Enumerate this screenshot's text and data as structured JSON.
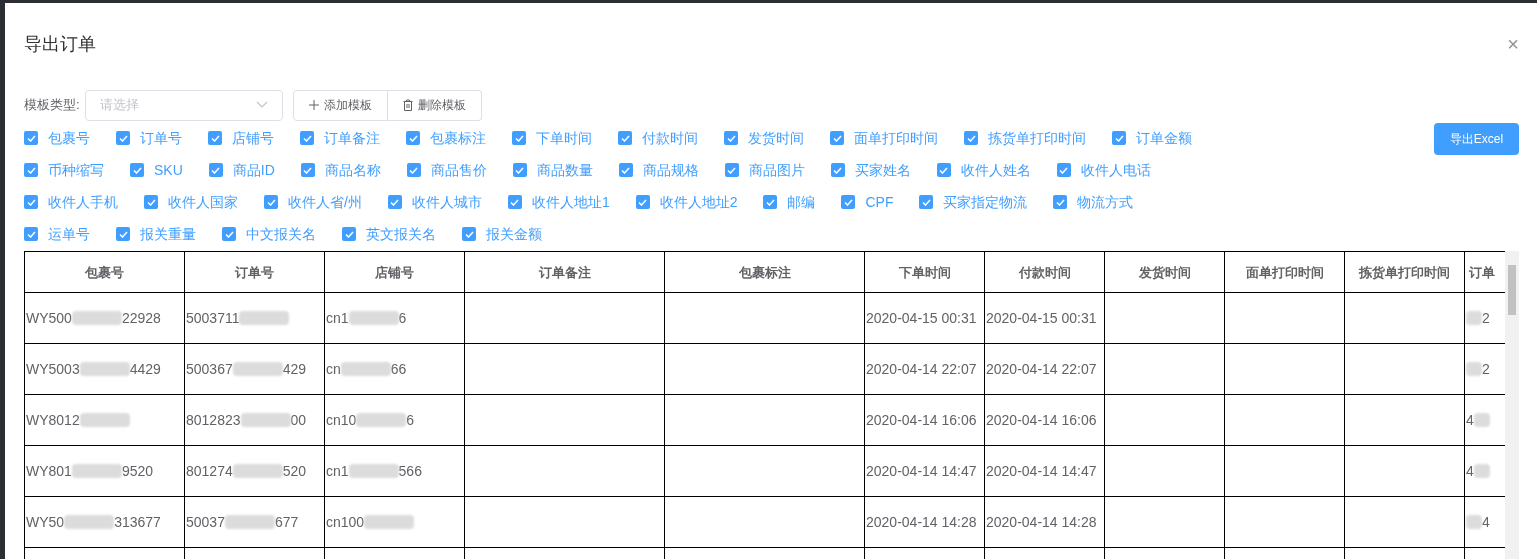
{
  "dialog": {
    "title": "导出订单",
    "close": "×"
  },
  "template": {
    "label": "模板类型:",
    "placeholder": "请选择",
    "add_button": "添加模板",
    "delete_button": "删除模板"
  },
  "export_button": "导出Excel",
  "field_rows": [
    [
      {
        "label": "包裹号",
        "checked": true
      },
      {
        "label": "订单号",
        "checked": true
      },
      {
        "label": "店铺号",
        "checked": true
      },
      {
        "label": "订单备注",
        "checked": true
      },
      {
        "label": "包裹标注",
        "checked": true
      },
      {
        "label": "下单时间",
        "checked": true
      },
      {
        "label": "付款时间",
        "checked": true
      },
      {
        "label": "发货时间",
        "checked": true
      },
      {
        "label": "面单打印时间",
        "checked": true
      },
      {
        "label": "拣货单打印时间",
        "checked": true
      },
      {
        "label": "订单金额",
        "checked": true
      }
    ],
    [
      {
        "label": "币种缩写",
        "checked": true
      },
      {
        "label": "SKU",
        "checked": true
      },
      {
        "label": "商品ID",
        "checked": true
      },
      {
        "label": "商品名称",
        "checked": true
      },
      {
        "label": "商品售价",
        "checked": true
      },
      {
        "label": "商品数量",
        "checked": true
      },
      {
        "label": "商品规格",
        "checked": true
      },
      {
        "label": "商品图片",
        "checked": true
      },
      {
        "label": "买家姓名",
        "checked": true
      },
      {
        "label": "收件人姓名",
        "checked": true
      },
      {
        "label": "收件人电话",
        "checked": true
      }
    ],
    [
      {
        "label": "收件人手机",
        "checked": true
      },
      {
        "label": "收件人国家",
        "checked": true
      },
      {
        "label": "收件人省/州",
        "checked": true
      },
      {
        "label": "收件人城市",
        "checked": true
      },
      {
        "label": "收件人地址1",
        "checked": true
      },
      {
        "label": "收件人地址2",
        "checked": true
      },
      {
        "label": "邮编",
        "checked": true
      },
      {
        "label": "CPF",
        "checked": true
      },
      {
        "label": "买家指定物流",
        "checked": true
      },
      {
        "label": "物流方式",
        "checked": true
      }
    ],
    [
      {
        "label": "运单号",
        "checked": true
      },
      {
        "label": "报关重量",
        "checked": true
      },
      {
        "label": "中文报关名",
        "checked": true
      },
      {
        "label": "英文报关名",
        "checked": true
      },
      {
        "label": "报关金额",
        "checked": true
      }
    ]
  ],
  "table": {
    "columns": [
      "包裹号",
      "订单号",
      "店铺号",
      "订单备注",
      "包裹标注",
      "下单时间",
      "付款时间",
      "发货时间",
      "面单打印时间",
      "拣货单打印时间",
      "订单"
    ],
    "rows": [
      [
        [
          "WY500",
          "22928"
        ],
        [
          "5003711",
          ""
        ],
        [
          "cn1",
          "6"
        ],
        [],
        [],
        [
          "2020-04-15 00:31"
        ],
        [
          "2020-04-15 00:31"
        ],
        [],
        [],
        [],
        [
          "",
          "2"
        ]
      ],
      [
        [
          "WY5003",
          "4429"
        ],
        [
          "500367",
          "429"
        ],
        [
          "cn",
          "66"
        ],
        [],
        [],
        [
          "2020-04-14 22:07"
        ],
        [
          "2020-04-14 22:07"
        ],
        [],
        [],
        [],
        [
          "",
          "2"
        ]
      ],
      [
        [
          "WY8012",
          ""
        ],
        [
          "8012823",
          "00"
        ],
        [
          "cn10",
          "6"
        ],
        [],
        [],
        [
          "2020-04-14 16:06"
        ],
        [
          "2020-04-14 16:06"
        ],
        [],
        [],
        [],
        [
          "4",
          ""
        ]
      ],
      [
        [
          "WY801",
          "9520"
        ],
        [
          "801274",
          "520"
        ],
        [
          "cn1",
          "566"
        ],
        [],
        [],
        [
          "2020-04-14 14:47"
        ],
        [
          "2020-04-14 14:47"
        ],
        [],
        [],
        [],
        [
          "4",
          ""
        ]
      ],
      [
        [
          "WY50",
          "313677"
        ],
        [
          "50037",
          "677"
        ],
        [
          "cn100",
          ""
        ],
        [],
        [],
        [
          "2020-04-14 14:28"
        ],
        [
          "2020-04-14 14:28"
        ],
        [],
        [],
        [],
        [
          "",
          "4"
        ]
      ]
    ]
  }
}
